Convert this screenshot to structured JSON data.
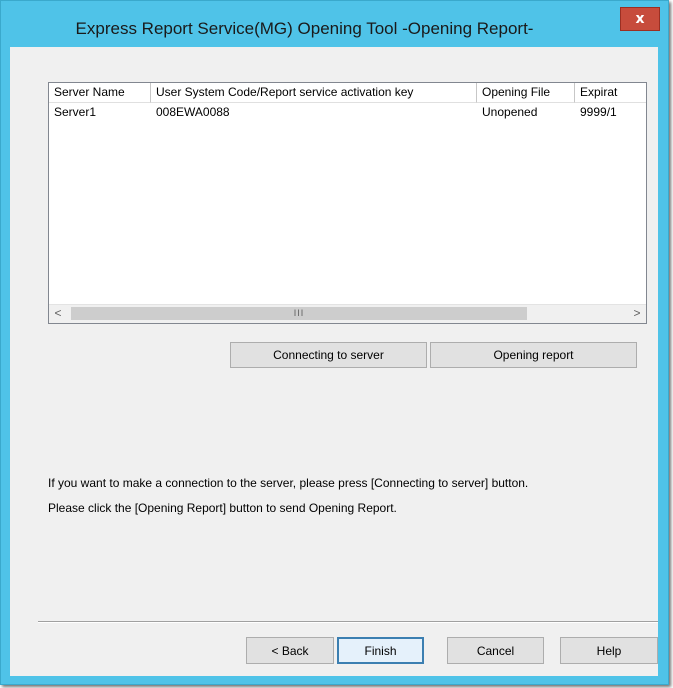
{
  "window": {
    "title": "Express Report Service(MG)  Opening Tool  -Opening Report-",
    "close_glyph": "x"
  },
  "listview": {
    "columns": [
      "Server Name",
      "User System Code/Report service activation key",
      "Opening File",
      "Expirat"
    ],
    "rows": [
      [
        "Server1",
        "008EWA0088",
        "Unopened",
        "9999/1"
      ]
    ],
    "scroll_left_glyph": "<",
    "scroll_right_glyph": ">",
    "scroll_thumb_grip": "III"
  },
  "actions": {
    "connect_label": "Connecting to server",
    "open_report_label": "Opening report"
  },
  "messages": {
    "line1": "If you want to make a connection to the server, please press [Connecting to server] button.",
    "line2": "Please click the [Opening Report] button to send Opening Report."
  },
  "footer": {
    "back_label": "< Back",
    "finish_label": "Finish",
    "cancel_label": "Cancel",
    "help_label": "Help"
  },
  "colors": {
    "title_bar": "#4fc3e8",
    "close_button": "#c74c3c",
    "dialog_background": "#f0f0f0"
  }
}
